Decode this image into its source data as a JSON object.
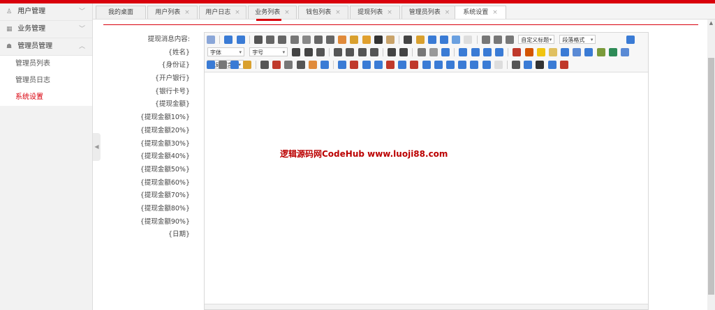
{
  "sidebar": {
    "groups": [
      {
        "label": "用户管理",
        "icon": "user-icon",
        "arrow": "﹀"
      },
      {
        "label": "业务管理",
        "icon": "grid-icon",
        "arrow": "﹀"
      },
      {
        "label": "管理员管理",
        "icon": "person-icon",
        "arrow": "︿"
      }
    ],
    "items": [
      {
        "label": "管理员列表"
      },
      {
        "label": "管理员日志"
      },
      {
        "label": "系统设置"
      }
    ]
  },
  "tabs": [
    {
      "label": "我的桌面",
      "close": ""
    },
    {
      "label": "用户列表",
      "close": "×"
    },
    {
      "label": "用户日志",
      "close": "×"
    },
    {
      "label": "业务列表",
      "close": "×"
    },
    {
      "label": "钱包列表",
      "close": "×"
    },
    {
      "label": "提现列表",
      "close": "×"
    },
    {
      "label": "管理员列表",
      "close": "×"
    },
    {
      "label": "系统设置",
      "close": "×"
    }
  ],
  "form": {
    "labels": [
      "提现消息内容:",
      "{姓名}",
      "{身份证}",
      "{开户银行}",
      "{银行卡号}",
      "{提现金额}",
      "{提现金额10%}",
      "{提现金额20%}",
      "{提现金额30%}",
      "{提现金额40%}",
      "{提现金额50%}",
      "{提现金额60%}",
      "{提现金额70%}",
      "{提现金额80%}",
      "{提现金额90%}",
      "{日期}"
    ]
  },
  "editor": {
    "selects": {
      "custom_title": "自定义标题",
      "paragraph": "段落格式",
      "font_family": "字体",
      "font_size": "字号",
      "code_lang": "代码语言"
    },
    "content_text": "逻辑源码网CodeHub  www.luoji88.com",
    "colors": {
      "accent": "#d9000c",
      "watermark": "#b00000"
    }
  }
}
